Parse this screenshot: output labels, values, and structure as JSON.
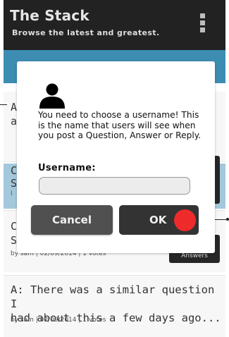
{
  "header": {
    "title": "The Stack",
    "subtitle": "Browse the latest and greatest."
  },
  "background_list": {
    "item1": {
      "line1": "A",
      "line2": "a"
    },
    "item2": {
      "line1": "C",
      "line2": "S",
      "meta": "I"
    },
    "item3": {
      "line1": "C",
      "line2": "S",
      "meta": "by sam | 02/09/2014 | 1 votes",
      "answers_label": "Answers"
    },
    "item4": {
      "line1": "A: There was a similar question I",
      "line2": "had about this a few days ago...",
      "meta": "by sam | 02/09/2014 | 1 votes"
    }
  },
  "dialog": {
    "message": "You need to choose a username! This is the name that users will see when you post a Question, Answer or Reply.",
    "username_label": "Username:",
    "username_value": "",
    "cancel_label": "Cancel",
    "ok_label": "OK"
  },
  "colors": {
    "header_bg": "#222222",
    "accent_blue": "#3d8db2",
    "highlight_row": "#a3c8db",
    "tap_marker": "#ef2a2a"
  },
  "icons": {
    "menu": "overflow-menu-icon",
    "user": "user-icon"
  }
}
